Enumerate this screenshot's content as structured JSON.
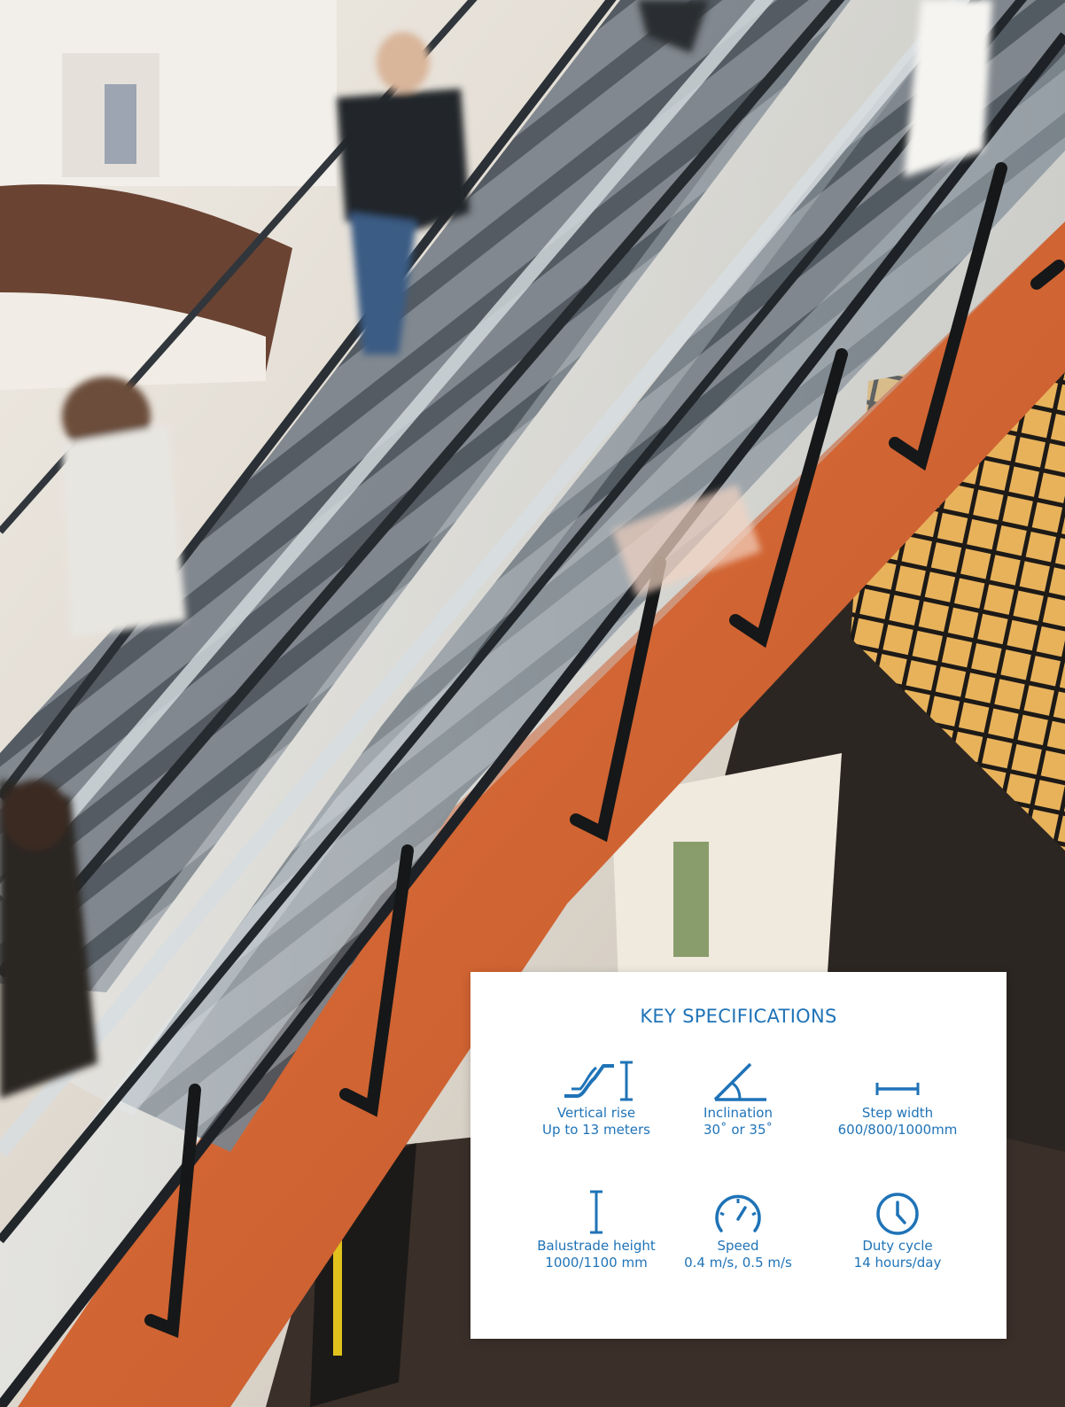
{
  "photo": {
    "subject": "escalator-in-shopping-mall",
    "colors": {
      "wall": "#e7e2da",
      "floor": "#3a322c",
      "orange_side": "#d6652f",
      "steps": "#6c737b",
      "glass": "#c9d3d8",
      "handrail": "#202428"
    }
  },
  "specs_card": {
    "title": "KEY SPECIFICATIONS",
    "accent_color": "#1f73b7",
    "items": [
      {
        "icon": "vertical-rise-icon",
        "label": "Vertical rise",
        "value": "Up to 13 meters"
      },
      {
        "icon": "inclination-angle-icon",
        "label": "Inclination",
        "value": "30˚ or 35˚"
      },
      {
        "icon": "step-width-icon",
        "label": "Step width",
        "value": "600/800/1000mm"
      },
      {
        "icon": "balustrade-height-icon",
        "label": "Balustrade height",
        "value": "1000/1100 mm"
      },
      {
        "icon": "speedometer-icon",
        "label": "Speed",
        "value": "0.4 m/s, 0.5 m/s"
      },
      {
        "icon": "clock-icon",
        "label": "Duty cycle",
        "value": "14 hours/day"
      }
    ]
  }
}
